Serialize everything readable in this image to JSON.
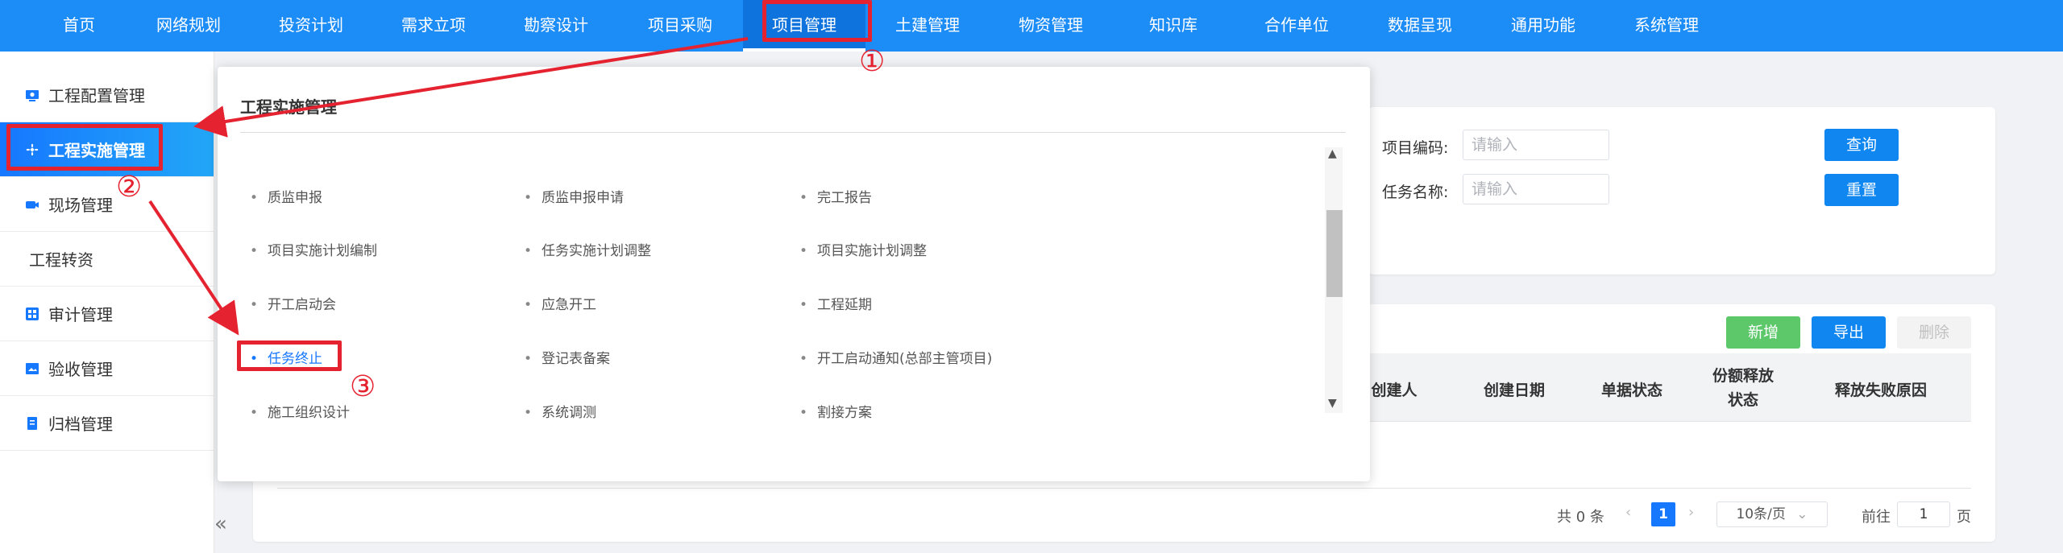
{
  "topnav": {
    "items": [
      "首页",
      "网络规划",
      "投资计划",
      "需求立项",
      "勘察设计",
      "项目采购",
      "项目管理",
      "土建管理",
      "物资管理",
      "知识库",
      "合作单位",
      "数据呈现",
      "通用功能",
      "系统管理"
    ],
    "active_index": 6
  },
  "sidebar": {
    "items": [
      "工程配置管理",
      "工程实施管理",
      "现场管理",
      "工程转资",
      "审计管理",
      "验收管理",
      "归档管理"
    ],
    "active_index": 1,
    "collapse_glyph": "«"
  },
  "search": {
    "code_label": "项目编码:",
    "code_placeholder": "请输入",
    "name_label": "任务名称:",
    "name_placeholder": "请输入",
    "query_label": "查询",
    "reset_label": "重置"
  },
  "table": {
    "add_label": "新增",
    "export_label": "导出",
    "delete_label": "删除",
    "headers": [
      "创建人",
      "创建日期",
      "单据状态",
      "份额释放\n状态",
      "释放失败原因"
    ]
  },
  "pager": {
    "total": "共 0 条",
    "current_page": "1",
    "page_size": "10条/页",
    "goto_prefix": "前往",
    "goto_value": "1",
    "goto_suffix": "页"
  },
  "dropdown": {
    "title": "工程实施管理",
    "rows": [
      [
        "质监申报",
        "质监申报申请",
        "完工报告"
      ],
      [
        "项目实施计划编制",
        "任务实施计划调整",
        "项目实施计划调整"
      ],
      [
        "开工启动会",
        "应急开工",
        "工程延期"
      ],
      [
        "任务终止",
        "登记表备案",
        "开工启动通知(总部主管项目)"
      ],
      [
        "施工组织设计",
        "系统调测",
        "割接方案"
      ]
    ],
    "highlight": "任务终止"
  },
  "annotations": {
    "step1": "①",
    "step2": "②",
    "step3": "③",
    "color": "#e52330"
  },
  "colors": {
    "brand_blue": "#1c8cf6",
    "button_blue": "#0f86f0",
    "button_green": "#5cc86a"
  }
}
